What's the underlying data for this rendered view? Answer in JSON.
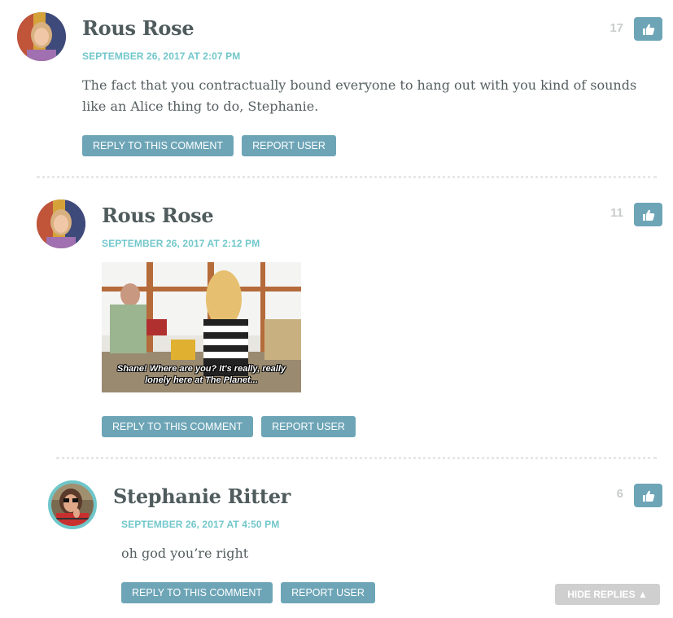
{
  "comments": [
    {
      "author": "Rous Rose",
      "date": "SEPTEMBER 26, 2017 AT 2:07 PM",
      "text": "The fact that you contractually bound everyone to hang out with you kind of sounds like an Alice thing to do, Stephanie.",
      "likes": "17",
      "reply_label": "REPLY TO THIS COMMENT",
      "report_label": "REPORT USER",
      "avatar_icon": "avatar-photo"
    },
    {
      "author": "Rous Rose",
      "date": "SEPTEMBER 26, 2017 AT 2:12 PM",
      "gif_caption": "Shane! Where are you? It's really, really lonely here at The Planet...",
      "likes": "11",
      "reply_label": "REPLY TO THIS COMMENT",
      "report_label": "REPORT USER",
      "avatar_icon": "avatar-photo"
    },
    {
      "author": "Stephanie Ritter",
      "date": "SEPTEMBER 26, 2017 AT 4:50 PM",
      "text": "oh god you’re right",
      "likes": "6",
      "reply_label": "REPLY TO THIS COMMENT",
      "report_label": "REPORT USER",
      "avatar_icon": "avatar-photo"
    }
  ],
  "hide_replies_label": "HIDE REPLIES ▲",
  "icons": {
    "like": "thumbs-up-icon"
  },
  "colors": {
    "accent_button": "#6da5b7",
    "date": "#72c7cb",
    "author": "#4f5b5c",
    "count": "#c9cbcc",
    "hide_replies": "#cfcfcf",
    "avatar_ring": "#6ec6c9"
  }
}
